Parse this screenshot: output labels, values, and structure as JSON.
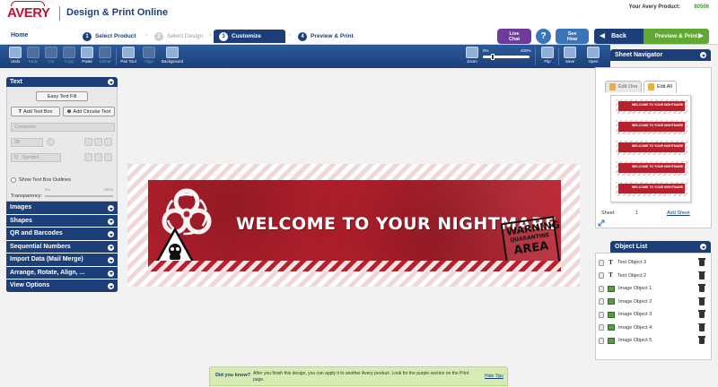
{
  "header": {
    "logo": "AVERY",
    "app_title": "Design & Print Online",
    "product_label": "Your Avery Product:",
    "product_code": "80506"
  },
  "nav": {
    "home": "Home",
    "steps": [
      {
        "num": "1",
        "label": "Select Product"
      },
      {
        "num": "2",
        "label": "Select Design"
      },
      {
        "num": "3",
        "label": "Customize"
      },
      {
        "num": "4",
        "label": "Preview & Print"
      }
    ],
    "live_chat": "Live Chat",
    "help": "?",
    "see_how": "See How",
    "back": "Back",
    "preview_print": "Preview & Print"
  },
  "toolbar": {
    "undo": "Undo",
    "redo": "Redo",
    "cut": "Cut",
    "copy": "Copy",
    "paste": "Paste",
    "delete": "Delete",
    "pan_tool": "Pan Tool",
    "align": "Align",
    "background": "Background",
    "zoom": "Zoom",
    "zoom_min": "0%",
    "zoom_max": "400%",
    "flip": "Flip",
    "save": "Save",
    "open": "Open"
  },
  "text_panel": {
    "title": "Text",
    "easy_text_fill": "Easy Text Fill",
    "add_text_box": "Add Text Box",
    "add_circular_text": "Add Circular Text",
    "font": "Creepster",
    "font_size": "38",
    "symbol": "Symbol",
    "show_outlines": "Show Text Box Outlines",
    "transparency": "Transparency:",
    "trans_min": "0%",
    "trans_max": "100%"
  },
  "accordion": [
    "Images",
    "Shapes",
    "QR and Barcodes",
    "Sequential Numbers",
    "Import Data (Mail Merge)",
    "Arrange, Rotate, Align, ...",
    "View Options"
  ],
  "label": {
    "headline": "WELCOME TO YOUR NIGHTMARE",
    "warning_1": "WARNING",
    "warning_2": "QUARANTINE",
    "warning_3": "AREA"
  },
  "sheet_navigator": {
    "title": "Sheet Navigator",
    "edit_one": "Edit One",
    "edit_all": "Edit All",
    "thumb_text": "WELCOME TO YOUR NIGHTMARE",
    "sheet_label": "Sheet",
    "sheet_num": "1",
    "add_sheet": "Add Sheet"
  },
  "object_list": {
    "title": "Object List",
    "items": [
      {
        "type": "text",
        "label": "Text Object 3"
      },
      {
        "type": "text",
        "label": "Text Object 2"
      },
      {
        "type": "image",
        "label": "Image Object 1"
      },
      {
        "type": "image",
        "label": "Image Object 2"
      },
      {
        "type": "image",
        "label": "Image Object 3"
      },
      {
        "type": "image",
        "label": "Image Object 4"
      },
      {
        "type": "image",
        "label": "Image Object 5"
      }
    ]
  },
  "tip": {
    "label": "Did you know?",
    "text": "After you finish this design, you can apply it to another Avery product.  Look for the purple section on the Print page.",
    "hide": "Hide Tips"
  },
  "colors": {
    "brand_red": "#c4122f",
    "nav_blue": "#1c3f7a",
    "label_red": "#b8202d",
    "action_green": "#5fa832",
    "live_chat_purple": "#6e3a9c"
  }
}
